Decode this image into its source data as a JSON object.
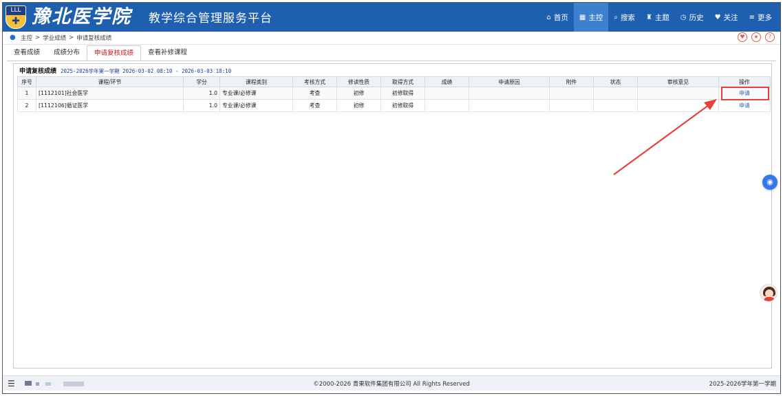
{
  "header": {
    "school_name": "豫北医学院",
    "logo_text": "LLL",
    "platform_name": "教学综合管理服务平台",
    "nav": [
      {
        "label": "首页",
        "icon": "home-icon",
        "glyph": "⌂",
        "active": false
      },
      {
        "label": "主控",
        "icon": "grid-icon",
        "glyph": "▦",
        "active": true
      },
      {
        "label": "搜索",
        "icon": "search-icon",
        "glyph": "⌕",
        "active": false
      },
      {
        "label": "主题",
        "icon": "shirt-icon",
        "glyph": "♜",
        "active": false
      },
      {
        "label": "历史",
        "icon": "clock-icon",
        "glyph": "◷",
        "active": false
      },
      {
        "label": "关注",
        "icon": "heart-icon",
        "glyph": "♥",
        "active": false
      },
      {
        "label": "更多",
        "icon": "menu-icon",
        "glyph": "≡",
        "active": false
      }
    ]
  },
  "breadcrumb": {
    "items": [
      "主控",
      "学业成绩",
      "申请复核成绩"
    ],
    "separator": ">"
  },
  "tabs": [
    {
      "label": "查看成绩",
      "active": false
    },
    {
      "label": "成绩分布",
      "active": false
    },
    {
      "label": "申请复核成绩",
      "active": true
    },
    {
      "label": "查看补修课程",
      "active": false
    }
  ],
  "section": {
    "title": "申请复核成绩",
    "period": "2025-2026学年第一学期 2026-03-02 08:10 - 2026-03-03 18:10"
  },
  "table": {
    "columns": [
      "序号",
      "课程/环节",
      "学分",
      "课程类别",
      "考核方式",
      "修读性质",
      "取得方式",
      "成绩",
      "申请原因",
      "附件",
      "状态",
      "审核意见",
      "操作"
    ],
    "rows": [
      {
        "no": "1",
        "course": "[1112101]社会医学",
        "credit": "1.0",
        "category": "专业课/必修课",
        "exam": "考查",
        "nature": "初修",
        "obtain": "初修取得",
        "score": "",
        "reason": "",
        "attachment": "",
        "status": "",
        "review": "",
        "action": "申请"
      },
      {
        "no": "2",
        "course": "[1112106]循证医学",
        "credit": "1.0",
        "category": "专业课/必修课",
        "exam": "考查",
        "nature": "初修",
        "obtain": "初修取得",
        "score": "",
        "reason": "",
        "attachment": "",
        "status": "",
        "review": "",
        "action": "申请"
      }
    ]
  },
  "footer": {
    "copyright": "©2000-2026 青果软件集团有限公司 All Rights Reserved",
    "term": "2025-2026学年第一学期"
  },
  "colors": {
    "header_bg": "#1f5fb0",
    "active_nav_bg": "#3d80d0",
    "active_tab_text": "#d02020",
    "highlight": "#e8413a",
    "link": "#1f5fb0"
  }
}
